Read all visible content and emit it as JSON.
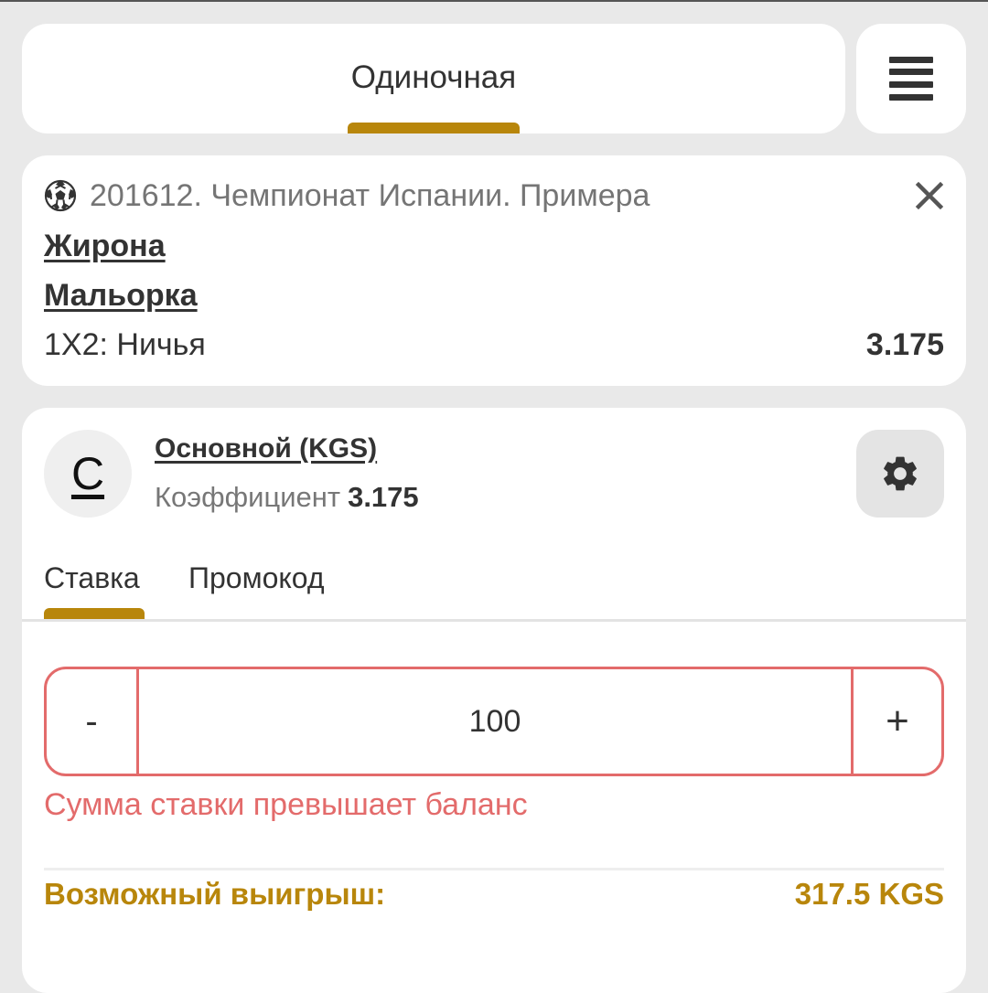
{
  "top_tabs": {
    "single_label": "Одиночная"
  },
  "event": {
    "league": "201612. Чемпионат Испании. Примера",
    "team1": "Жирона",
    "team2": "Мальорка",
    "market": "1X2: Ничья",
    "odds": "3.175"
  },
  "account": {
    "avatar_letter": "C",
    "name": "Основной (KGS)",
    "coef_label": "Коэффициент",
    "coef_value": "3.175"
  },
  "sub_tabs": {
    "stake_label": "Ставка",
    "promo_label": "Промокод"
  },
  "stake": {
    "minus_label": "-",
    "value": "100",
    "plus_label": "+",
    "error": "Сумма ставки превышает баланс"
  },
  "winnings": {
    "label": "Возможный выигрыш:",
    "value": "317.5 KGS"
  },
  "colors": {
    "accent": "#b8860b",
    "error": "#e36b6b",
    "background": "#e9e9e9"
  }
}
